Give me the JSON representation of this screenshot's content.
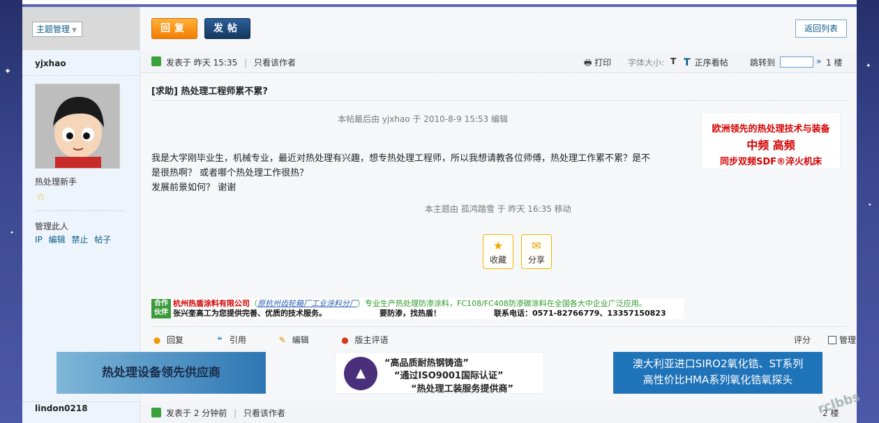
{
  "sidebar": {
    "topic_manage": "主题管理",
    "user1": "yjxhao",
    "rank": "热处理新手",
    "manage_label": "管理此人",
    "manage_links": [
      "IP",
      "编辑",
      "禁止",
      "帖子"
    ],
    "user2": "lindon0218"
  },
  "toolbar": {
    "reply": "回复",
    "new_post": "发帖",
    "back": "返回列表"
  },
  "post1": {
    "posted_at_label": "发表于",
    "posted_time": "昨天 15:35",
    "only_author": "只看该作者",
    "print": "打印",
    "font_size": "字体大小:",
    "font_t": "T",
    "order": "正序看帖",
    "jump": "跳转到",
    "floor": "1 楼",
    "title": "[求助] 热处理工程师累不累?",
    "edited_note": "本帖最后由 yjxhao 于 2010-8-9 15:53 编辑",
    "content_line1": "我是大学刚毕业生，机械专业，最近对热处理有兴趣，想专热处理工程师，所以我想请教各位师傅，热处理工作累不累？是不",
    "content_line2": "是很热啊？  或者哪个热处理工作很热？",
    "content_line3": "发展前景如何？        谢谢",
    "moved_note": "本主题由 孤鸿踏雪 于 昨天 16:35 移动",
    "favorite": "收藏",
    "share": "分享",
    "actions": [
      "回复",
      "引用",
      "编辑",
      "版主评语"
    ],
    "rate": "评分",
    "manage": "管理"
  },
  "ad_right": {
    "line1": "欧洲领先的热处理技术与装备",
    "line2": "中频    高频",
    "line3": "同步双频SDF®淬火机床"
  },
  "partner": {
    "tag": "合作伙伴",
    "company": "杭州热盾涂料有限公司",
    "former": "原杭州齿轮箱厂工业涂料分厂",
    "desc": "专业生产热处理防渗涂料，FC108/FC408防渗碳涂料在全国各大中企业广泛应用。",
    "row2a": "张兴奎高工为您提供完善、优质的技术服务。",
    "row2b": "要防渗，找热盾！",
    "row2c": "联系电话：0571-82766779、13357150823"
  },
  "banners": {
    "b1": "热处理设备领先供应商",
    "b2_l1": "“高品质耐热钢铸造”",
    "b2_l2": "“通过ISO9001国际认证”",
    "b2_l3": "“热处理工装服务提供商”",
    "b3_l1": "澳大利亚进口SIRO2氧化锆、ST系列",
    "b3_l2": "高性价比HMA系列氧化锆氧探头"
  },
  "post2": {
    "posted_at_label": "发表于",
    "posted_time": "2 分钟前",
    "only_author": "只看该作者",
    "floor": "2 楼"
  },
  "watermark": "rclbbs"
}
